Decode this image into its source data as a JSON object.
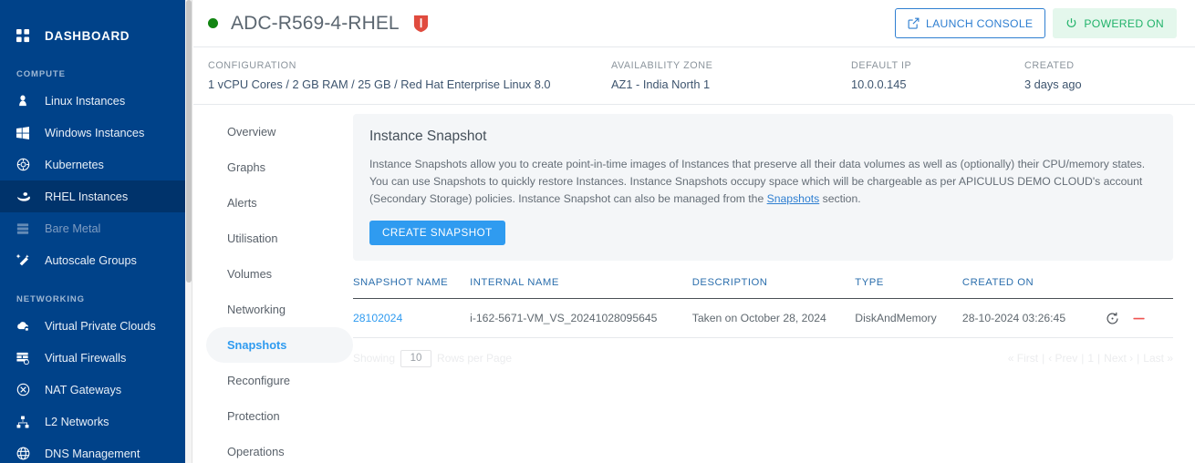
{
  "sidebar": {
    "brand": {
      "label": "DASHBOARD",
      "icon": "grid-icon"
    },
    "groups": [
      {
        "title": "COMPUTE",
        "items": [
          {
            "label": "Linux Instances",
            "icon": "linux-penguin-icon",
            "active": false,
            "dim": false
          },
          {
            "label": "Windows Instances",
            "icon": "windows-icon",
            "active": false,
            "dim": false
          },
          {
            "label": "Kubernetes",
            "icon": "kubernetes-icon",
            "active": false,
            "dim": false
          },
          {
            "label": "RHEL Instances",
            "icon": "redhat-icon",
            "active": true,
            "dim": false
          },
          {
            "label": "Bare Metal",
            "icon": "server-rack-icon",
            "active": false,
            "dim": true
          },
          {
            "label": "Autoscale Groups",
            "icon": "autoscale-icon",
            "active": false,
            "dim": false
          }
        ]
      },
      {
        "title": "NETWORKING",
        "items": [
          {
            "label": "Virtual Private Clouds",
            "icon": "cloud-lock-icon",
            "active": false,
            "dim": false
          },
          {
            "label": "Virtual Firewalls",
            "icon": "firewall-icon",
            "active": false,
            "dim": false
          },
          {
            "label": "NAT Gateways",
            "icon": "nat-gateway-icon",
            "active": false,
            "dim": false
          },
          {
            "label": "L2 Networks",
            "icon": "network-tree-icon",
            "active": false,
            "dim": false
          },
          {
            "label": "DNS Management",
            "icon": "globe-icon",
            "active": false,
            "dim": false
          }
        ]
      }
    ]
  },
  "header": {
    "status_dot_color": "#128512",
    "instance_name": "ADC-R569-4-RHEL",
    "shield_icon": "redhat-shield-icon",
    "shield_color": "#e04b3e",
    "launch_console": {
      "label": "LAUNCH CONSOLE",
      "icon": "external-link-icon"
    },
    "power_badge": {
      "label": "POWERED ON",
      "icon": "power-icon",
      "color": "#22b36b",
      "bg": "#e4f7ec"
    }
  },
  "meta": [
    {
      "label": "CONFIGURATION",
      "value": "1 vCPU Cores / 2 GB RAM / 25 GB / Red Hat Enterprise Linux 8.0"
    },
    {
      "label": "AVAILABILITY ZONE",
      "value": "AZ1 - India North 1"
    },
    {
      "label": "DEFAULT IP",
      "value": "10.0.0.145"
    },
    {
      "label": "CREATED",
      "value": "3 days ago"
    }
  ],
  "tabs": [
    {
      "label": "Overview",
      "active": false
    },
    {
      "label": "Graphs",
      "active": false
    },
    {
      "label": "Alerts",
      "active": false
    },
    {
      "label": "Utilisation",
      "active": false
    },
    {
      "label": "Volumes",
      "active": false
    },
    {
      "label": "Networking",
      "active": false
    },
    {
      "label": "Snapshots",
      "active": true
    },
    {
      "label": "Reconfigure",
      "active": false
    },
    {
      "label": "Protection",
      "active": false
    },
    {
      "label": "Operations",
      "active": false
    }
  ],
  "panel": {
    "title": "Instance Snapshot",
    "description_part1": "Instance Snapshots allow you to create point-in-time images of Instances that preserve all their data volumes as well as (optionally) their CPU/memory states. You can use Snapshots to quickly restore Instances. Instance Snapshots occupy space which will be chargeable as per APICULUS DEMO CLOUD's account (Secondary Storage) policies. Instance Snapshot can also be managed from the ",
    "description_link": "Snapshots",
    "description_part2": " section.",
    "create_button": "CREATE SNAPSHOT"
  },
  "table": {
    "columns": [
      "SNAPSHOT NAME",
      "INTERNAL NAME",
      "DESCRIPTION",
      "TYPE",
      "CREATED ON"
    ],
    "rows": [
      {
        "snapshot_name": "28102024",
        "internal_name": "i-162-5671-VM_VS_20241028095645",
        "description": "Taken on October 28, 2024",
        "type": "DiskAndMemory",
        "created_on": "28-10-2024 03:26:45",
        "actions": [
          "revert-icon",
          "delete-icon"
        ]
      }
    ]
  },
  "pager": {
    "showing_label": "Showing",
    "rows_per_page_value": "10",
    "rows_per_page_label": "Rows per Page",
    "first": "« First",
    "sep1": "|",
    "prev": "‹ Prev",
    "sep2": "|",
    "page": "1",
    "sep3": "|",
    "next": "Next ›",
    "sep4": "|",
    "last": "Last »"
  }
}
